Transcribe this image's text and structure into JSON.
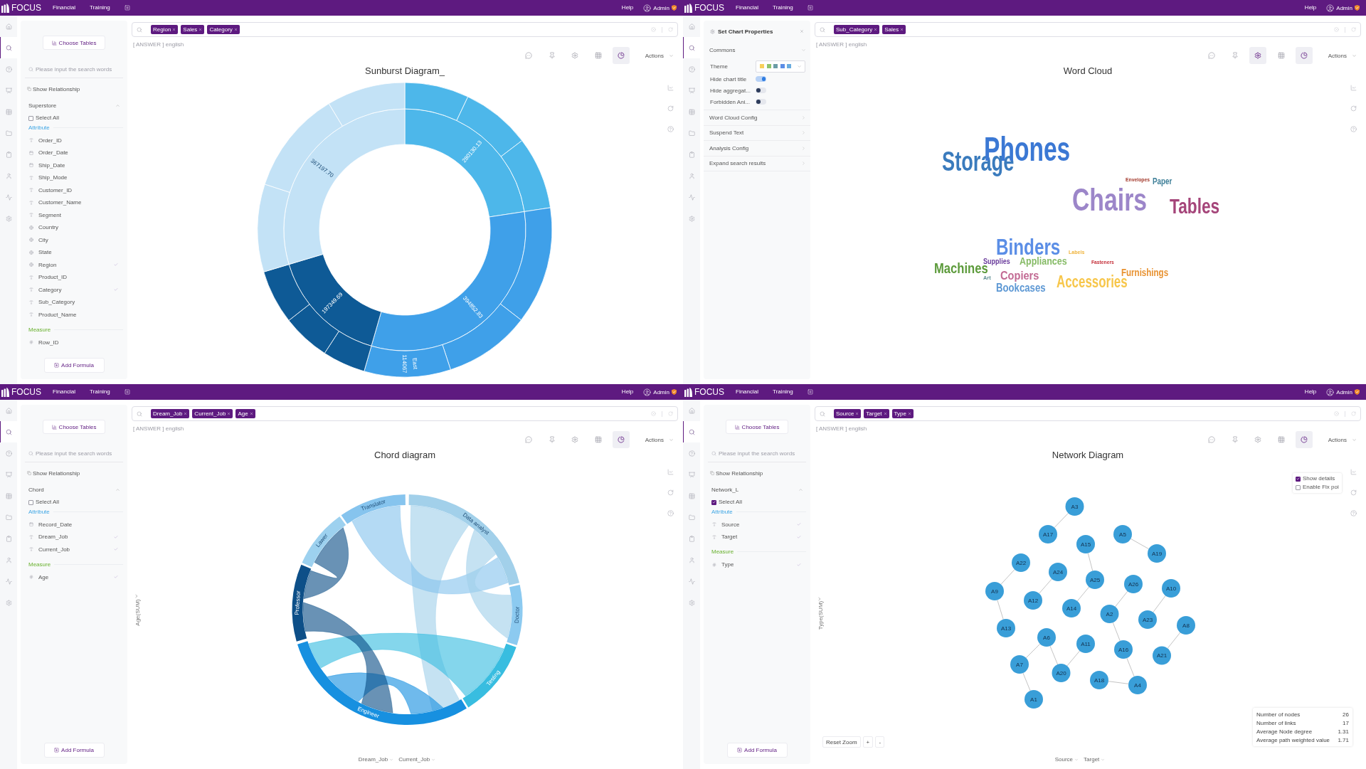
{
  "panels": [
    {
      "top_bar": {
        "logo": "FOCUS",
        "nav": [
          "Financial",
          "Training"
        ],
        "help": "Help",
        "user": "Admin"
      },
      "rail": [
        {
          "selected": false
        },
        {
          "selected": true
        },
        {
          "selected": false
        },
        {
          "selected": false
        },
        {
          "selected": false
        },
        {
          "selected": false
        },
        {
          "selected": false
        },
        {
          "selected": false
        },
        {
          "selected": false
        },
        {
          "selected": false
        }
      ],
      "side_panel": {
        "kind": "fields",
        "choose_button": "Choose Tables",
        "search_placeholder": "Please input the search words",
        "relationship": "Show Relationship",
        "table": {
          "name": "Superstore",
          "expanded": true
        },
        "select_all": {
          "label": "Select All",
          "checked": false
        },
        "groups": [
          {
            "kind": "attribute",
            "label": "Attribute",
            "fields": [
              {
                "label": "Order_ID",
                "kind": "text",
                "checked": false
              },
              {
                "label": "Order_Date",
                "kind": "date",
                "checked": false
              },
              {
                "label": "Ship_Date",
                "kind": "date",
                "checked": false
              },
              {
                "label": "Ship_Mode",
                "kind": "text",
                "checked": false
              },
              {
                "label": "Customer_ID",
                "kind": "text",
                "checked": false
              },
              {
                "label": "Customer_Name",
                "kind": "text",
                "checked": false
              },
              {
                "label": "Segment",
                "kind": "text",
                "checked": false
              },
              {
                "label": "Country",
                "kind": "geo",
                "checked": false
              },
              {
                "label": "City",
                "kind": "geo",
                "checked": false
              },
              {
                "label": "State",
                "kind": "geo",
                "checked": false
              },
              {
                "label": "Region",
                "kind": "geo",
                "checked": true
              },
              {
                "label": "Product_ID",
                "kind": "text",
                "checked": false
              },
              {
                "label": "Category",
                "kind": "text",
                "checked": true
              },
              {
                "label": "Sub_Category",
                "kind": "text",
                "checked": false
              },
              {
                "label": "Product_Name",
                "kind": "text",
                "checked": false
              }
            ]
          },
          {
            "kind": "measure",
            "label": "Measure",
            "fields": [
              {
                "label": "Row_ID",
                "kind": "number",
                "checked": false
              }
            ]
          }
        ],
        "formula_button": "Add Formula"
      },
      "search": {
        "tokens": [
          "Region",
          "Sales",
          "Category"
        ],
        "hint": "[ ANSWER ] english"
      },
      "toolbar": [
        {
          "selected": false
        },
        {
          "selected": false
        },
        {
          "selected": false
        },
        {
          "selected": false
        },
        {
          "selected": true
        }
      ],
      "actions": "Actions",
      "chart": {
        "kind": "sunburst",
        "title": "Sunburst Diagram_",
        "chart_data": {
          "type": "donut",
          "series": [
            {
              "values": [
                22.6,
                31.86,
                15.92,
                29.62
              ],
              "colors": [
                "#4db7ea",
                "#3fa0e9",
                "#0e5a96",
                "#c3e2f6"
              ]
            }
          ],
          "value_labels": [
            "280130.13",
            "394852.83",
            "197349.69",
            "367197.70"
          ]
        },
        "outer_ring_labels": [
          "114067",
          "East"
        ]
      }
    },
    {
      "top_bar": {
        "logo": "FOCUS",
        "nav": [
          "Financial",
          "Training"
        ],
        "help": "Help",
        "user": "Admin"
      },
      "rail": [
        {
          "selected": false
        },
        {
          "selected": true
        },
        {
          "selected": false
        },
        {
          "selected": false
        },
        {
          "selected": false
        },
        {
          "selected": false
        },
        {
          "selected": false
        },
        {
          "selected": false
        },
        {
          "selected": false
        },
        {
          "selected": false
        }
      ],
      "side_panel": {
        "kind": "properties",
        "title": "Set Chart Properties",
        "sections": [
          {
            "label": "Commons",
            "expanded": true,
            "rows": [
              {
                "kind": "theme",
                "label": "Theme",
                "swatches": [
                  {
                    "color": "#f8cf5b"
                  },
                  {
                    "color": "#8dc26d"
                  },
                  {
                    "color": "#6b9ca6"
                  },
                  {
                    "color": "#5b8de6"
                  },
                  {
                    "color": "#6aaddf"
                  }
                ]
              },
              {
                "kind": "toggle",
                "label": "Hide chart title",
                "on": true
              },
              {
                "kind": "toggle",
                "label": "Hide aggregat...",
                "on": false
              },
              {
                "kind": "toggle",
                "label": "Forbidden Ani...",
                "on": false
              }
            ]
          },
          {
            "label": "Word Cloud Config",
            "expanded": false
          },
          {
            "label": "Suspend Text",
            "expanded": false
          },
          {
            "label": "Analysis Config",
            "expanded": false
          },
          {
            "label": "Expand search results",
            "expanded": false
          }
        ]
      },
      "search": {
        "tokens": [
          "Sub_Category",
          "Sales"
        ],
        "hint": "[ ANSWER ] english"
      },
      "toolbar": [
        {
          "selected": false
        },
        {
          "selected": false
        },
        {
          "selected": true
        },
        {
          "selected": false
        },
        {
          "selected": true
        }
      ],
      "actions": "Actions",
      "chart": {
        "kind": "word_cloud",
        "title": "Word Cloud",
        "words": [
          {
            "text": "Storage",
            "color": "#3a7bbd"
          },
          {
            "text": "Phones",
            "color": "#3b78d4"
          },
          {
            "text": "Envelopes",
            "color": "#a3392c"
          },
          {
            "text": "Paper",
            "color": "#3e7f98"
          },
          {
            "text": "Chairs",
            "color": "#9c86c9"
          },
          {
            "text": "Tables",
            "color": "#a5457a"
          },
          {
            "text": "Binders",
            "color": "#5b8ee6"
          },
          {
            "text": "Labels",
            "color": "#f0b43c"
          },
          {
            "text": "Machines",
            "color": "#5d9b3c"
          },
          {
            "text": "Supplies",
            "color": "#6a3c9c"
          },
          {
            "text": "Appliances",
            "color": "#86bb66"
          },
          {
            "text": "Fasteners",
            "color": "#c5303a"
          },
          {
            "text": "Art",
            "color": "#5c8c90"
          },
          {
            "text": "Copiers",
            "color": "#c26a93"
          },
          {
            "text": "Bookcases",
            "color": "#5d98d4"
          },
          {
            "text": "Accessories",
            "color": "#f7c64a"
          },
          {
            "text": "Furnishings",
            "color": "#e8912f"
          }
        ]
      }
    },
    {
      "top_bar": {
        "logo": "FOCUS",
        "nav": [
          "Financial",
          "Training"
        ],
        "help": "Help",
        "user": "Admin"
      },
      "rail": [
        {
          "selected": false
        },
        {
          "selected": true
        },
        {
          "selected": false
        },
        {
          "selected": false
        },
        {
          "selected": false
        },
        {
          "selected": false
        },
        {
          "selected": false
        },
        {
          "selected": false
        },
        {
          "selected": false
        },
        {
          "selected": false
        }
      ],
      "side_panel": {
        "kind": "fields",
        "choose_button": "Choose Tables",
        "search_placeholder": "Please input the search words",
        "relationship": "Show Relationship",
        "table": {
          "name": "Chord",
          "expanded": true
        },
        "select_all": {
          "label": "Select All",
          "checked": false
        },
        "groups": [
          {
            "kind": "attribute",
            "label": "Attribute",
            "fields": [
              {
                "label": "Record_Date",
                "kind": "date",
                "checked": false
              },
              {
                "label": "Dream_Job",
                "kind": "text",
                "checked": true
              },
              {
                "label": "Current_Job",
                "kind": "text",
                "checked": true
              }
            ]
          },
          {
            "kind": "measure",
            "label": "Measure",
            "fields": [
              {
                "label": "Age",
                "kind": "number",
                "checked": true
              }
            ]
          }
        ],
        "formula_button": "Add Formula"
      },
      "search": {
        "tokens": [
          "Dream_Job",
          "Current_Job",
          "Age"
        ],
        "hint": "[ ANSWER ] english"
      },
      "toolbar": [
        {
          "selected": false
        },
        {
          "selected": false
        },
        {
          "selected": false
        },
        {
          "selected": false
        },
        {
          "selected": true
        }
      ],
      "actions": "Actions",
      "chart": {
        "kind": "chord",
        "title": "Chord diagram",
        "y_axis": "Age(SUM)",
        "x_axis": [
          "Dream_Job",
          "Current_Job"
        ],
        "groups": [
          {
            "label": "Translator",
            "color": "#86c4ee"
          },
          {
            "label": "Data analyst",
            "color": "#a2d0ea"
          },
          {
            "label": "Doctor",
            "color": "#8ccaf0"
          },
          {
            "label": "Testing",
            "color": "#38bde0"
          },
          {
            "label": "Engineer",
            "color": "#1790e0"
          },
          {
            "label": "Professor",
            "color": "#0d4f88"
          },
          {
            "label": "Lawer",
            "color": "#9dd1ef"
          }
        ]
      }
    },
    {
      "top_bar": {
        "logo": "FOCUS",
        "nav": [
          "Financial",
          "Training"
        ],
        "help": "Help",
        "user": "Admin"
      },
      "rail": [
        {
          "selected": false
        },
        {
          "selected": true
        },
        {
          "selected": false
        },
        {
          "selected": false
        },
        {
          "selected": false
        },
        {
          "selected": false
        },
        {
          "selected": false
        },
        {
          "selected": false
        },
        {
          "selected": false
        },
        {
          "selected": false
        }
      ],
      "side_panel": {
        "kind": "fields",
        "choose_button": "Choose Tables",
        "search_placeholder": "Please input the search words",
        "relationship": "Show Relationship",
        "table": {
          "name": "Network_L",
          "expanded": true
        },
        "select_all": {
          "label": "Select All",
          "checked": true
        },
        "groups": [
          {
            "kind": "attribute",
            "label": "Attribute",
            "fields": [
              {
                "label": "Source",
                "kind": "text",
                "checked": true
              },
              {
                "label": "Target",
                "kind": "text",
                "checked": true
              }
            ]
          },
          {
            "kind": "measure",
            "label": "Measure",
            "fields": [
              {
                "label": "Type",
                "kind": "number",
                "checked": true
              }
            ]
          }
        ],
        "formula_button": "Add Formula"
      },
      "search": {
        "tokens": [
          "Source",
          "Target",
          "Type"
        ],
        "hint": "[ ANSWER ] english"
      },
      "toolbar": [
        {
          "selected": false
        },
        {
          "selected": false
        },
        {
          "selected": false
        },
        {
          "selected": false
        },
        {
          "selected": true
        }
      ],
      "actions": "Actions",
      "chart": {
        "kind": "network",
        "title": "Network Diagram",
        "y_axis": "Type(SUM)",
        "x_axis": [
          "Source",
          "Target"
        ],
        "nodes": [
          {
            "label": "A3"
          },
          {
            "label": "A17"
          },
          {
            "label": "A5"
          },
          {
            "label": "A15"
          },
          {
            "label": "A19"
          },
          {
            "label": "A22"
          },
          {
            "label": "A24"
          },
          {
            "label": "A25"
          },
          {
            "label": "A26"
          },
          {
            "label": "A10"
          },
          {
            "label": "A9"
          },
          {
            "label": "A12"
          },
          {
            "label": "A14"
          },
          {
            "label": "A2"
          },
          {
            "label": "A23"
          },
          {
            "label": "A8"
          },
          {
            "label": "A13"
          },
          {
            "label": "A6"
          },
          {
            "label": "A11"
          },
          {
            "label": "A16"
          },
          {
            "label": "A21"
          },
          {
            "label": "A7"
          },
          {
            "label": "A20"
          },
          {
            "label": "A18"
          },
          {
            "label": "A4"
          },
          {
            "label": "A1"
          }
        ],
        "options": [
          {
            "label": "Show details",
            "checked": true
          },
          {
            "label": "Enable Fix poi",
            "checked": false
          }
        ],
        "stats": [
          {
            "label": "Number of nodes",
            "value": "26"
          },
          {
            "label": "Number of links",
            "value": "17"
          },
          {
            "label": "Average Node degree",
            "value": "1.31"
          },
          {
            "label": "Average path weighted value",
            "value": "1.71"
          }
        ],
        "zoom_controls": [
          "Reset Zoom",
          "+",
          "-"
        ]
      }
    }
  ]
}
